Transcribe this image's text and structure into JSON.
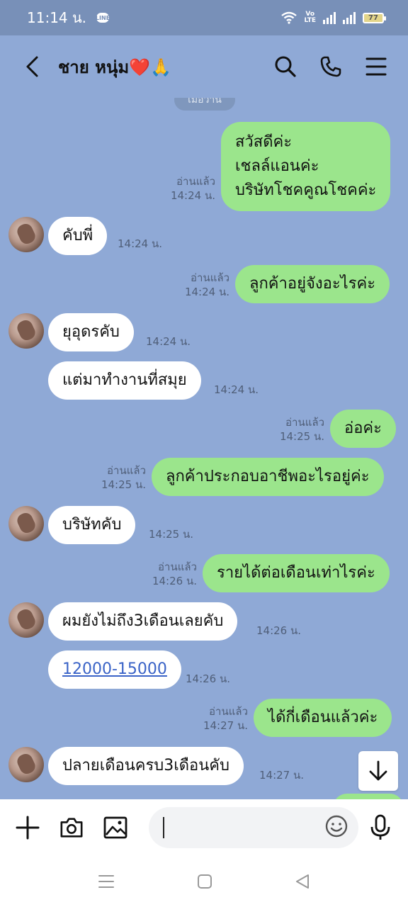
{
  "status_bar": {
    "time": "11:14 น.",
    "app_badge": "LINE",
    "network": "VoLTE",
    "battery": "77"
  },
  "header": {
    "contact_name": "ชาย หนุ่ม❤️🙏",
    "back_icon": "chevron-left-icon",
    "search_icon": "search-icon",
    "call_icon": "phone-icon",
    "menu_icon": "menu-icon"
  },
  "date_chip": "เมื่อวาน",
  "messages": [
    {
      "dir": "out",
      "lines": [
        "สวัสดีค่ะ",
        "เชลล์แอนค่ะ",
        "บริษัทโชคคูณโชคค่ะ"
      ],
      "read": "อ่านแล้ว",
      "time": "14:24 น."
    },
    {
      "dir": "in",
      "text": "คับพี่",
      "time": "14:24 น."
    },
    {
      "dir": "out",
      "text": "ลูกค้าอยู่จังอะไรค่ะ",
      "read": "อ่านแล้ว",
      "time": "14:24 น."
    },
    {
      "dir": "in",
      "text": "ยุอุดรคับ",
      "time": "14:24 น."
    },
    {
      "dir": "in",
      "text": "แต่มาทำงานที่สมุย",
      "time": "14:24 น."
    },
    {
      "dir": "out",
      "text": "อ่อค่ะ",
      "read": "อ่านแล้ว",
      "time": "14:25 น."
    },
    {
      "dir": "out",
      "text": "ลูกค้าประกอบอาชีพอะไรอยู่ค่ะ",
      "read": "อ่านแล้ว",
      "time": "14:25 น."
    },
    {
      "dir": "in",
      "text": "บริษัทคับ",
      "time": "14:25 น."
    },
    {
      "dir": "out",
      "text": "รายได้ต่อเดือนเท่าไรค่ะ",
      "read": "อ่านแล้ว",
      "time": "14:26 น."
    },
    {
      "dir": "in",
      "text": "ผมยังไม่ถึง3เดือนเลยคับ",
      "time": "14:26 น."
    },
    {
      "dir": "in",
      "text": "12000-15000",
      "time": "14:26 น.",
      "link": true
    },
    {
      "dir": "out",
      "text": "ได้กี่เดือนแล้วค่ะ",
      "read": "อ่านแล้ว",
      "time": "14:27 น."
    },
    {
      "dir": "in",
      "text": "ปลายเดือนครบ3เดือนคับ",
      "time": "14:27 น."
    }
  ],
  "scroll_down_icon": "arrow-down-icon",
  "composer": {
    "plus_icon": "plus-icon",
    "camera_icon": "camera-icon",
    "image_icon": "image-icon",
    "input_value": "",
    "emoji_icon": "emoji-icon",
    "mic_icon": "microphone-icon"
  },
  "nav": {
    "recent_icon": "recent-apps-icon",
    "home_icon": "home-icon",
    "back_icon": "back-triangle-icon"
  }
}
